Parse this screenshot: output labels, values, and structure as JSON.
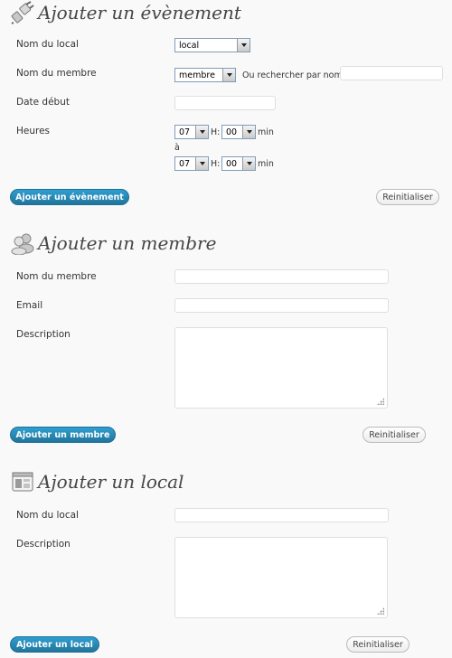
{
  "event": {
    "title": "Ajouter un évènement",
    "icon": "plug-icon",
    "local_label": "Nom du local",
    "local_select": "local",
    "member_label": "Nom du membre",
    "member_select": "membre",
    "search_label": "Ou rechercher par nom",
    "search_value": "",
    "date_label": "Date début",
    "date_value": "",
    "hours_label": "Heures",
    "start_hour": "07",
    "start_min": "00",
    "h_sep": "H:",
    "min_label": "min",
    "to_label": "à",
    "end_hour": "07",
    "end_min": "00",
    "submit": "Ajouter un évènement",
    "reset": "Reinitialiser"
  },
  "member": {
    "title": "Ajouter un membre",
    "icon": "users-icon",
    "name_label": "Nom du membre",
    "email_label": "Email",
    "description_label": "Description",
    "submit": "Ajouter un membre",
    "reset": "Reinitialiser"
  },
  "local": {
    "title": "Ajouter un local",
    "icon": "layout-icon",
    "name_label": "Nom du local",
    "description_label": "Description",
    "submit": "Ajouter un local",
    "reset": "Reinitialiser"
  },
  "colors": {
    "primary_button": "#21759b",
    "background": "#f9f9f9"
  }
}
